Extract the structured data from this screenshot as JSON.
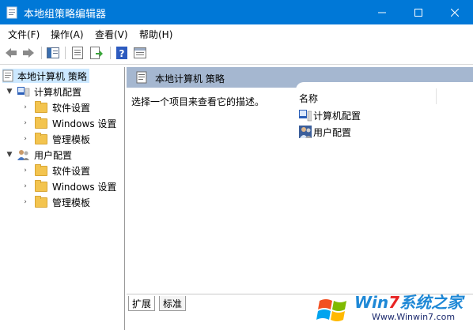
{
  "window": {
    "title": "本地组策略编辑器"
  },
  "menu": [
    {
      "label": "文件(F)"
    },
    {
      "label": "操作(A)"
    },
    {
      "label": "查看(V)"
    },
    {
      "label": "帮助(H)"
    }
  ],
  "tree": {
    "root": "本地计算机 策略",
    "computer": {
      "label": "计算机配置",
      "children": [
        "软件设置",
        "Windows 设置",
        "管理模板"
      ]
    },
    "user": {
      "label": "用户配置",
      "children": [
        "软件设置",
        "Windows 设置",
        "管理模板"
      ]
    }
  },
  "right": {
    "header": "本地计算机 策略",
    "description": "选择一个项目来查看它的描述。",
    "column": "名称",
    "items": [
      "计算机配置",
      "用户配置"
    ]
  },
  "tabs": [
    "扩展",
    "标准"
  ],
  "watermark": {
    "brand_a": "Win",
    "brand_b": "7",
    "brand_c": "系统之家",
    "url": "Www.Winwin7.com"
  },
  "colors": {
    "titlebar": "#0078d7",
    "header": "#a5b7d0",
    "selection": "#cce8ff"
  }
}
